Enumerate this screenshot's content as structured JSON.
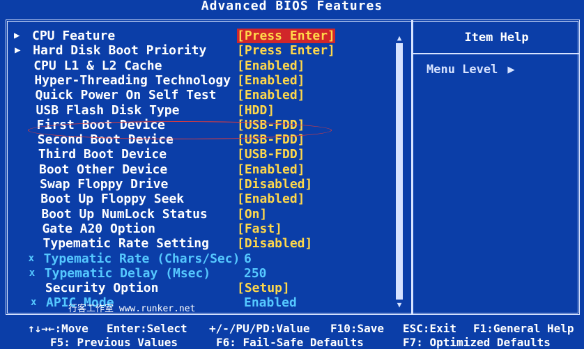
{
  "title": "Advanced BIOS Features",
  "help": {
    "title": "Item Help",
    "menu_level": "Menu Level"
  },
  "items": [
    {
      "label": "CPU Feature",
      "value": "[Press Enter]",
      "marker": "▶",
      "type": "normal",
      "selected": true
    },
    {
      "label": "Hard Disk Boot Priority",
      "value": "[Press Enter]",
      "marker": "▶",
      "type": "normal"
    },
    {
      "label": "CPU L1 & L2 Cache",
      "value": "[Enabled]",
      "type": "normal"
    },
    {
      "label": "Hyper-Threading Technology",
      "value": "[Enabled]",
      "type": "normal"
    },
    {
      "label": "Quick Power On Self Test",
      "value": "[Enabled]",
      "type": "normal"
    },
    {
      "label": "USB Flash Disk Type",
      "value": "[HDD]",
      "type": "normal"
    },
    {
      "label": "First Boot Device",
      "value": "[USB-FDD]",
      "type": "normal",
      "circled": true
    },
    {
      "label": "Second Boot Device",
      "value": "[USB-FDD]",
      "type": "normal"
    },
    {
      "label": "Third Boot Device",
      "value": "[USB-FDD]",
      "type": "normal"
    },
    {
      "label": "Boot Other Device",
      "value": "[Enabled]",
      "type": "normal"
    },
    {
      "label": "Swap Floppy Drive",
      "value": "[Disabled]",
      "type": "normal"
    },
    {
      "label": "Boot Up Floppy Seek",
      "value": "[Enabled]",
      "type": "normal"
    },
    {
      "label": "Boot Up NumLock Status",
      "value": "[On]",
      "type": "normal"
    },
    {
      "label": "Gate A20 Option",
      "value": "[Fast]",
      "type": "normal"
    },
    {
      "label": "Typematic Rate Setting",
      "value": "[Disabled]",
      "type": "normal"
    },
    {
      "label": "Typematic Rate (Chars/Sec)",
      "value": "6",
      "marker": "x",
      "type": "sub"
    },
    {
      "label": "Typematic Delay (Msec)",
      "value": "250",
      "marker": "x",
      "type": "sub"
    },
    {
      "label": "Security Option",
      "value": "[Setup]",
      "type": "normal"
    },
    {
      "label": "APIC Mode",
      "value": "Enabled",
      "marker": "x",
      "type": "sub"
    }
  ],
  "footer": {
    "line1": [
      {
        "text": "↑↓→←:Move"
      },
      {
        "text": "Enter:Select"
      },
      {
        "text": "+/-/PU/PD:Value"
      },
      {
        "text": "F10:Save"
      },
      {
        "text": "ESC:Exit"
      },
      {
        "text": "F1:General Help"
      }
    ],
    "line2": [
      {
        "text": "F5: Previous Values"
      },
      {
        "text": "F6: Fail-Safe Defaults"
      },
      {
        "text": "F7: Optimized Defaults"
      }
    ]
  },
  "watermark": "行客工作室 www.runker.net",
  "colors": {
    "background": "#0b3ea8",
    "label": "#ffffff",
    "value": "#ffd84a",
    "sub_item": "#55c8ff",
    "highlight": "#d1262a",
    "annotation_oval": "#e23b3b"
  },
  "icons": {
    "submenu": "triangle-right-icon",
    "disabled_item": "x-mark-icon",
    "scroll_up": "triangle-up-icon",
    "scroll_down": "triangle-down-icon"
  }
}
